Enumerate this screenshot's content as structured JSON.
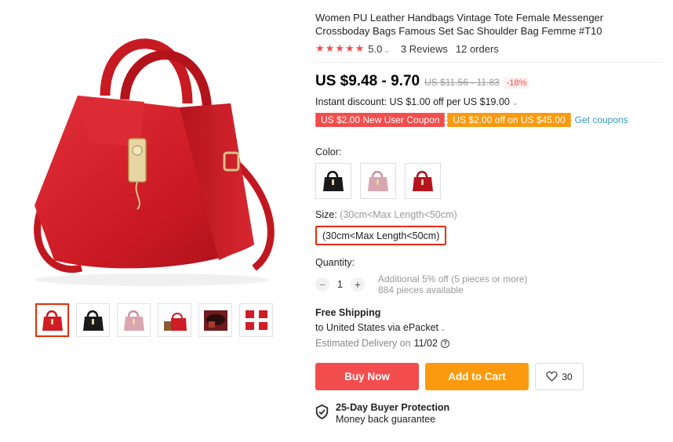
{
  "product": {
    "title": "Women PU Leather Handbags Vintage Tote Female Messenger Crossboday Bags Famous Set Sac Shoulder Bag Femme #T10",
    "stars": "★★★★★",
    "rating": "5.0",
    "reviews": "3 Reviews",
    "orders": "12 orders"
  },
  "price": {
    "current": "US $9.48 - 9.70",
    "original": "US $11.56 - 11.83",
    "discount": "-18%",
    "instant_discount": "Instant discount: US $1.00 off per US $19.00"
  },
  "coupons": {
    "new_user": "US $2.00 New User Coupon",
    "off": "US $2.00 off on US $45.00",
    "get": "Get coupons"
  },
  "color": {
    "label": "Color:",
    "options": [
      "black-bag",
      "pink-bag",
      "red-bag"
    ]
  },
  "size": {
    "label": "Size:",
    "hint": "(30cm<Max Length<50cm)",
    "option": "(30cm<Max Length<50cm)"
  },
  "quantity": {
    "label": "Quantity:",
    "minus": "−",
    "value": "1",
    "plus": "+",
    "additional": "Additional 5% off (5 pieces or more)",
    "available": "884 pieces available"
  },
  "shipping": {
    "title": "Free Shipping",
    "to": "to United States via ePacket",
    "est_label": "Estimated Delivery on",
    "est_date": "11/02"
  },
  "actions": {
    "buy_now": "Buy Now",
    "add_to_cart": "Add to Cart",
    "wishlist_count": "30"
  },
  "protection": {
    "title": "25-Day Buyer Protection",
    "subtitle": "Money back guarantee"
  },
  "colors": {
    "accent_red": "#f44d4d",
    "accent_orange": "#fb9a0f",
    "link_blue": "#2e9cc3",
    "bag_red": "#d01c24"
  }
}
